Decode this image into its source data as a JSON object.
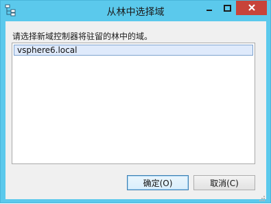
{
  "window": {
    "title": "从林中选择域",
    "icon": "directory-tree-icon",
    "controls": [
      "minimize-icon",
      "maximize-icon",
      "close-icon"
    ]
  },
  "dialog": {
    "prompt": "请选择新域控制器将驻留的林中的域。",
    "domains": [
      "vsphere6.local"
    ],
    "selected_index": 0
  },
  "buttons": {
    "ok_label": "确定(O)",
    "cancel_label": "取消(C)"
  },
  "colors": {
    "titlebar": "#5bc9ec",
    "close": "#c7443a",
    "selection": "#dfeafb"
  }
}
